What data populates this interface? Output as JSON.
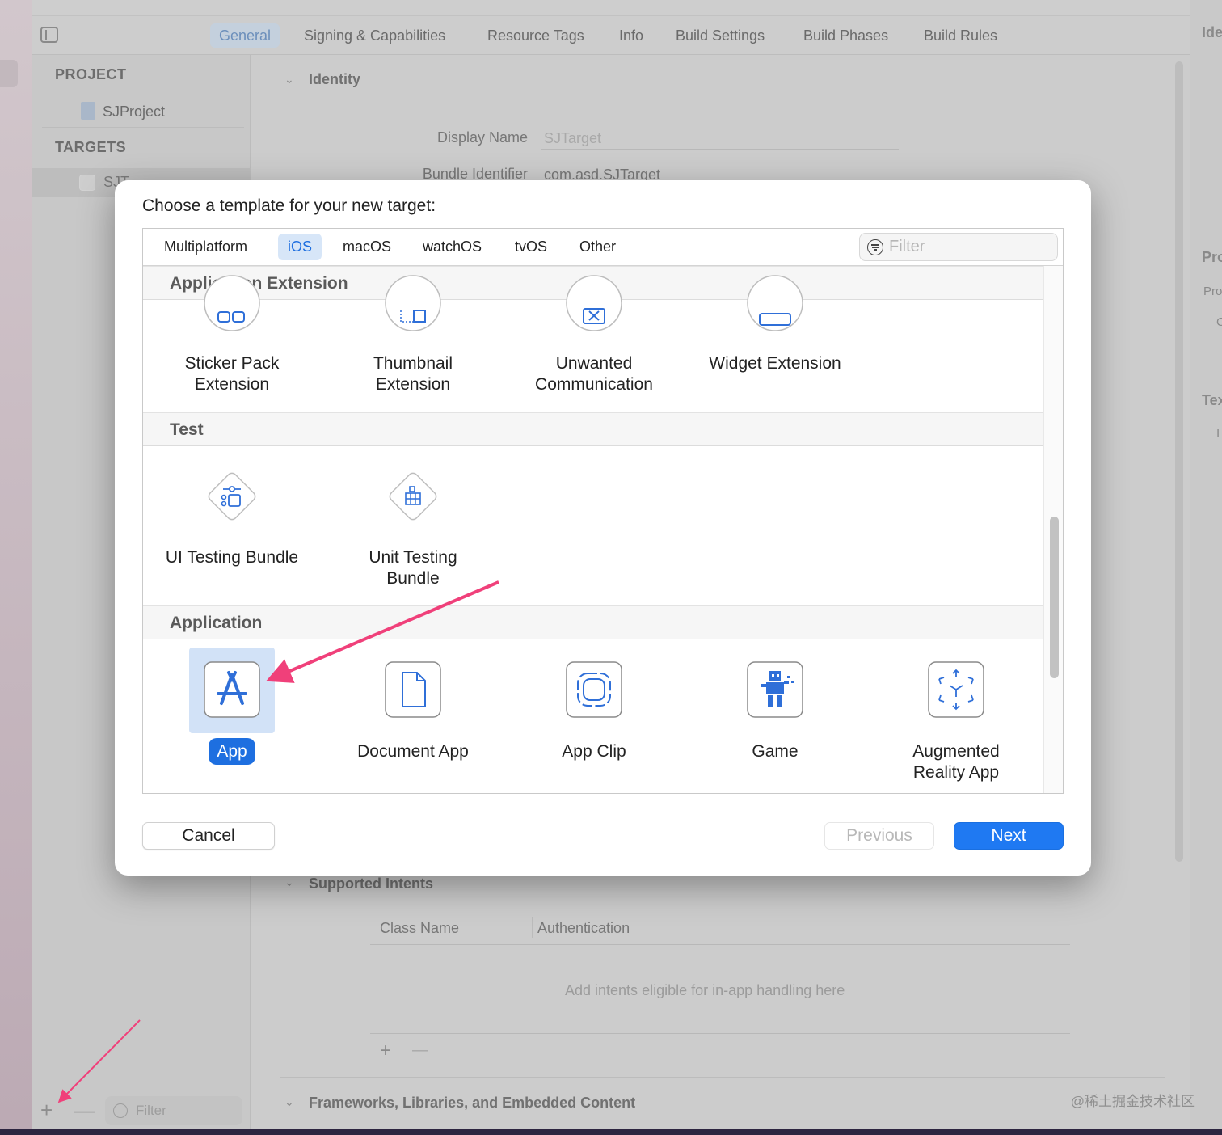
{
  "xcode": {
    "tabs": [
      "General",
      "Signing & Capabilities",
      "Resource Tags",
      "Info",
      "Build Settings",
      "Build Phases",
      "Build Rules"
    ],
    "active_tab": "General",
    "navigator": {
      "project_header": "PROJECT",
      "project_name": "SJProject",
      "targets_header": "TARGETS",
      "target_name": "SJT"
    },
    "identity": {
      "section": "Identity",
      "display_name_label": "Display Name",
      "display_name_placeholder": "SJTarget",
      "bundle_id_label": "Bundle Identifier",
      "bundle_id_value": "com.asd.SJTarget"
    },
    "supported_intents": {
      "section": "Supported Intents",
      "col_class": "Class Name",
      "col_auth": "Authentication",
      "empty_text": "Add intents eligible for in-app handling here",
      "add": "+",
      "remove": "—"
    },
    "frameworks_section": "Frameworks, Libraries, and Embedded Content",
    "inspector": {
      "t1": "Ide",
      "t2": "Pro",
      "s1": "Pro",
      "s2": "C",
      "t3": "Tex",
      "s3": "I"
    },
    "bottom": {
      "add": "+",
      "remove": "—",
      "filter_placeholder": "Filter"
    },
    "watermark": "@稀土掘金技术社区"
  },
  "dialog": {
    "title": "Choose a template for your new target:",
    "platforms": [
      "Multiplatform",
      "iOS",
      "macOS",
      "watchOS",
      "tvOS",
      "Other"
    ],
    "active_platform": "iOS",
    "filter_placeholder": "Filter",
    "sections": {
      "app_extension": {
        "title": "Application Extension",
        "items": [
          "Sticker Pack Extension",
          "Thumbnail Extension",
          "Unwanted Communication",
          "Widget Extension"
        ]
      },
      "test": {
        "title": "Test",
        "items": [
          "UI Testing Bundle",
          "Unit Testing Bundle"
        ]
      },
      "application": {
        "title": "Application",
        "items": [
          "App",
          "Document App",
          "App Clip",
          "Game",
          "Augmented Reality App"
        ],
        "selected": "App"
      }
    },
    "buttons": {
      "cancel": "Cancel",
      "previous": "Previous",
      "next": "Next"
    }
  },
  "colors": {
    "accent": "#1f79f2",
    "selection_bg": "#d2e2f7",
    "arrow": "#f0407a"
  }
}
